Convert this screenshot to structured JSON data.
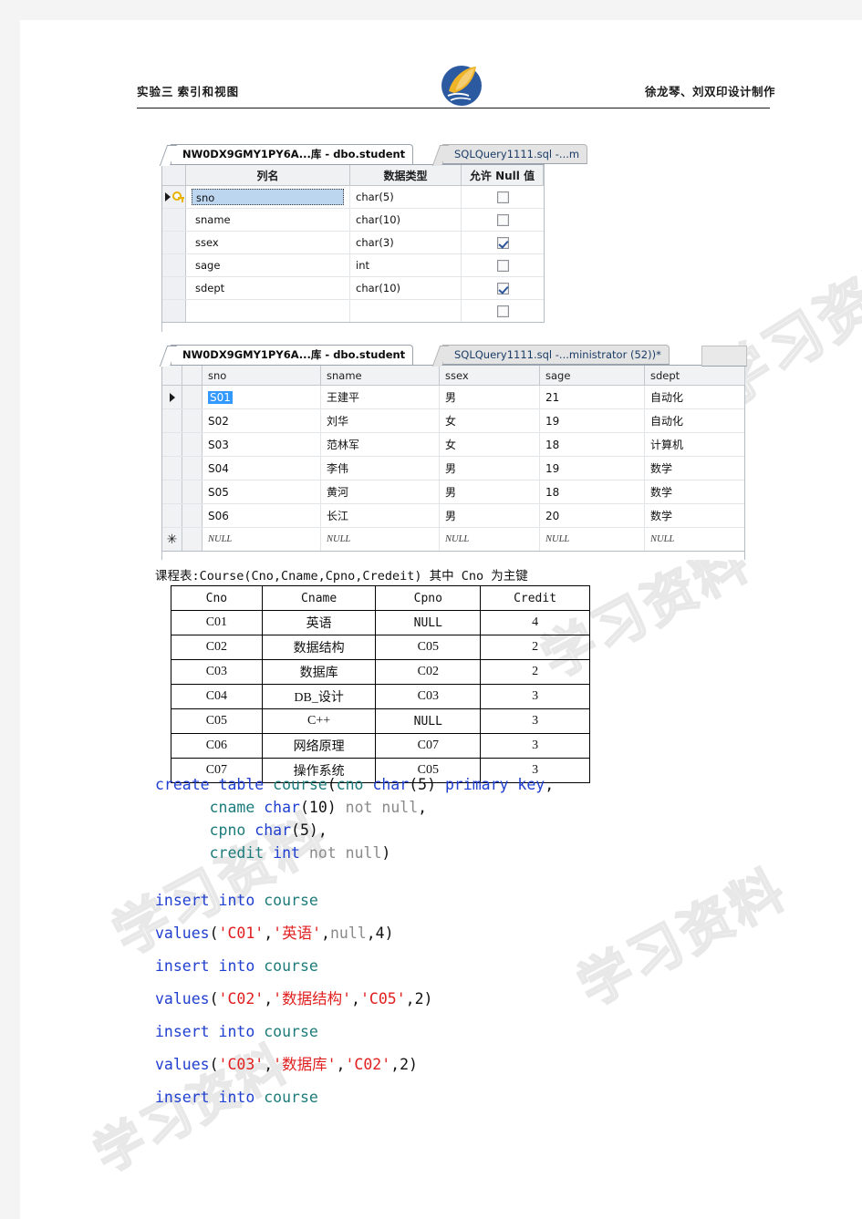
{
  "page": {
    "header": {
      "left_title": "实验三 索引和视图",
      "right_title": "徐龙琴、刘双印设计制作",
      "logo_name": "institution-logo"
    },
    "watermark_text": "学习资料"
  },
  "designer": {
    "tabs": [
      {
        "label": "NW0DX9GMY1PY6A...库 - dbo.student",
        "active": true
      },
      {
        "label": "SQLQuery1111.sql -...m",
        "active": false
      }
    ],
    "columns": [
      "列名",
      "数据类型",
      "允许 Null 值"
    ],
    "rows": [
      {
        "name": "sno",
        "type": "char(5)",
        "allow_null": false,
        "primary_key": true,
        "selected": true
      },
      {
        "name": "sname",
        "type": "char(10)",
        "allow_null": false,
        "primary_key": false,
        "selected": false
      },
      {
        "name": "ssex",
        "type": "char(3)",
        "allow_null": true,
        "primary_key": false,
        "selected": false
      },
      {
        "name": "sage",
        "type": "int",
        "allow_null": false,
        "primary_key": false,
        "selected": false
      },
      {
        "name": "sdept",
        "type": "char(10)",
        "allow_null": true,
        "primary_key": false,
        "selected": false
      },
      {
        "name": "",
        "type": "",
        "allow_null": false,
        "primary_key": false,
        "selected": false
      }
    ]
  },
  "datagrid": {
    "tabs": [
      {
        "label": "NW0DX9GMY1PY6A...库 - dbo.student",
        "active": true
      },
      {
        "label": "SQLQuery1111.sql -...ministrator (52))*",
        "active": false
      }
    ],
    "columns": [
      "sno",
      "sname",
      "ssex",
      "sage",
      "sdept"
    ],
    "rows": [
      {
        "indicator": "current",
        "sno": "S01",
        "sname": "王建平",
        "ssex": "男",
        "sage": "21",
        "sdept": "自动化",
        "sno_selected": true
      },
      {
        "indicator": "",
        "sno": "S02",
        "sname": "刘华",
        "ssex": "女",
        "sage": "19",
        "sdept": "自动化",
        "sno_selected": false
      },
      {
        "indicator": "",
        "sno": "S03",
        "sname": "范林军",
        "ssex": "女",
        "sage": "18",
        "sdept": "计算机",
        "sno_selected": false
      },
      {
        "indicator": "",
        "sno": "S04",
        "sname": "李伟",
        "ssex": "男",
        "sage": "19",
        "sdept": "数学",
        "sno_selected": false
      },
      {
        "indicator": "",
        "sno": "S05",
        "sname": "黄河",
        "ssex": "男",
        "sage": "18",
        "sdept": "数学",
        "sno_selected": false
      },
      {
        "indicator": "",
        "sno": "S06",
        "sname": "长江",
        "ssex": "男",
        "sage": "20",
        "sdept": "数学",
        "sno_selected": false
      },
      {
        "indicator": "new",
        "sno": "NULL",
        "sname": "NULL",
        "ssex": "NULL",
        "sage": "NULL",
        "sdept": "NULL",
        "sno_selected": false,
        "is_null_row": true
      }
    ]
  },
  "course_table": {
    "caption": "课程表:Course(Cno,Cname,Cpno,Credeit)  其中 Cno 为主键",
    "columns": [
      "Cno",
      "Cname",
      "Cpno",
      "Credit"
    ],
    "rows": [
      {
        "cno": "C01",
        "cname": "英语",
        "cpno": "NULL",
        "credit": "4"
      },
      {
        "cno": "C02",
        "cname": "数据结构",
        "cpno": "C05",
        "credit": "2"
      },
      {
        "cno": "C03",
        "cname": "数据库",
        "cpno": "C02",
        "credit": "2"
      },
      {
        "cno": "C04",
        "cname": "DB_设计",
        "cpno": "C03",
        "credit": "3"
      },
      {
        "cno": "C05",
        "cname": "C++",
        "cpno": "NULL",
        "credit": "3"
      },
      {
        "cno": "C06",
        "cname": "网络原理",
        "cpno": "C07",
        "credit": "3"
      },
      {
        "cno": "C07",
        "cname": "操作系统",
        "cpno": "C05",
        "credit": "3"
      }
    ]
  },
  "sql": {
    "lines": [
      "create table course(cno char(5) primary key,",
      "      cname char(10) not null,",
      "      cpno char(5),",
      "      credit int not null)",
      "insert into course",
      "values('C01','英语',null,4)",
      "insert into course",
      "values('C02','数据结构','C05',2)",
      "insert into course",
      "values('C03','数据库','C02',2)",
      "insert into course"
    ]
  }
}
